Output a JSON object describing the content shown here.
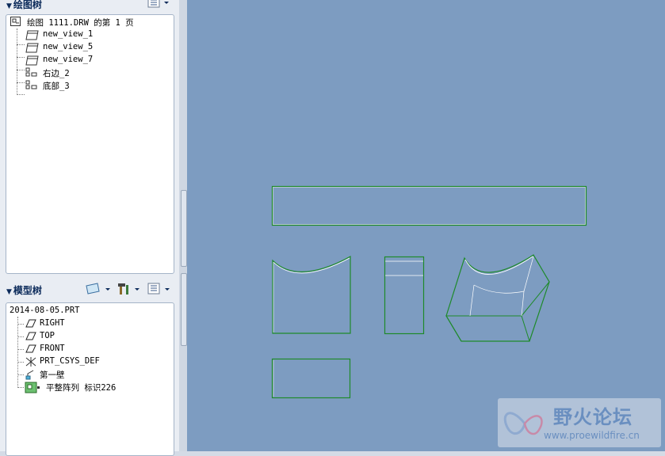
{
  "drawing_tree": {
    "title": "绘图树",
    "items": [
      {
        "label": "绘图 1111.DRW 的第 1 页",
        "icon": "sheet-icon"
      },
      {
        "label": "new_view_1",
        "icon": "view-icon"
      },
      {
        "label": "new_view_5",
        "icon": "view-icon"
      },
      {
        "label": "new_view_7",
        "icon": "view-icon"
      },
      {
        "label": "右边_2",
        "icon": "table-icon"
      },
      {
        "label": "底部_3",
        "icon": "table-icon"
      }
    ]
  },
  "model_tree": {
    "title": "模型树",
    "items": [
      {
        "label": "2014-08-05.PRT",
        "icon": "part-icon"
      },
      {
        "label": "RIGHT",
        "icon": "datum-plane-icon"
      },
      {
        "label": "TOP",
        "icon": "datum-plane-icon"
      },
      {
        "label": "FRONT",
        "icon": "datum-plane-icon"
      },
      {
        "label": "PRT_CSYS_DEF",
        "icon": "csys-icon"
      },
      {
        "label": "第一壁",
        "icon": "wall-icon"
      },
      {
        "label": "平整阵列 标识226",
        "icon": "pattern-icon"
      }
    ]
  },
  "watermark": {
    "title": "野火论坛",
    "url": "www.proewildfire.cn"
  },
  "colors": {
    "canvas": "#7d9cc1",
    "geometry_edge": "#1e8a2a",
    "geometry_face": "#ffffff"
  }
}
